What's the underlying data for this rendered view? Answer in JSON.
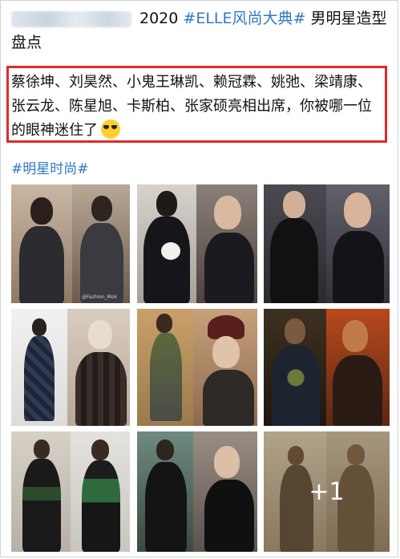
{
  "post": {
    "year": "2020",
    "topic_tag": "#ELLE风尚大典#",
    "title_rest": " 男明星造型",
    "title_line2": "盘点",
    "body": "蔡徐坤、刘昊然、小鬼王琳凯、赖冠霖、姚弛、梁靖康、张云龙、陈星旭、卡斯柏、张家硕亮相出席，你被哪一位的眼神迷住了",
    "emoji_icon": "cool-sunglasses-emoji-icon",
    "hashtag": "#明星时尚#"
  },
  "colors": {
    "link": "#2f78c8",
    "highlight_border": "#e12a2a"
  },
  "images": {
    "watermark": "@Fashion_Mok",
    "more_count": "+1",
    "items": [
      {
        "name": "photo-1"
      },
      {
        "name": "photo-2"
      },
      {
        "name": "photo-3"
      },
      {
        "name": "photo-4"
      },
      {
        "name": "photo-5"
      },
      {
        "name": "photo-6"
      },
      {
        "name": "photo-7"
      },
      {
        "name": "photo-8"
      },
      {
        "name": "photo-9"
      }
    ]
  }
}
